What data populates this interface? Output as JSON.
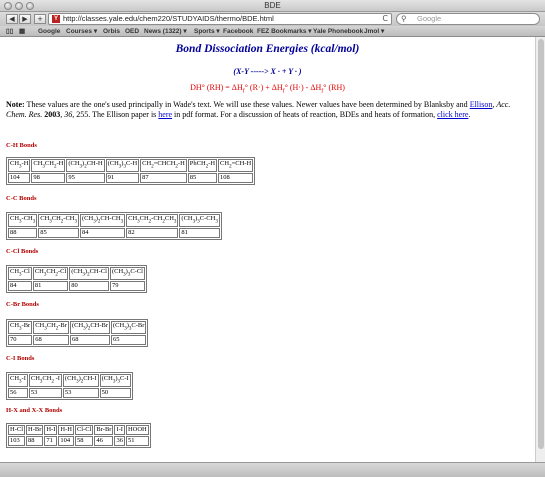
{
  "window": {
    "title": "BDE"
  },
  "toolbar": {
    "back": "◀",
    "forward": "▶",
    "add": "+",
    "url": "http://classes.yale.edu/chem220/STUDYAIDS/thermo/BDE.html",
    "reload": "C",
    "search_placeholder": "Google"
  },
  "bookmarks": [
    "Google",
    "Courses ▾",
    "Orbis",
    "OED",
    "News (1322) ▾",
    "Sports ▾",
    "Facebook",
    "FEZ Bookmarks ▾",
    "Yale Phonebook",
    "Jmol ▾"
  ],
  "page": {
    "heading": "Bond Dissociation Energies (kcal/mol)",
    "reaction": "(X-Y -----> X · + Y · )",
    "formula": "DH° (RH) = ΔHf° (R·) + ΔHf° (H·) - ΔHf° (RH)",
    "note": {
      "label": "Note:",
      "t1": " These values are the one's used principally in Wade's text. We will use these values. Newer values have been determined by Blanksby and ",
      "link1": "Ellison",
      "t2": ", ",
      "journal": "Acc. Chem. Res.",
      "t3": " ",
      "year": "2003",
      "t4": ", ",
      "vol": "36",
      "t5": ", 255. The Ellison paper is ",
      "link2": "here",
      "t6": " in pdf format. For a discussion of heats of reaction, BDEs and heats of formation, ",
      "link3": "click here",
      "t7": "."
    },
    "sections": [
      {
        "title": "C-H Bonds",
        "headers": [
          "CH3-H",
          "CH3CH2-H",
          "(CH3)2CH-H",
          "(CH3)3C-H",
          "CH2=CHCH2-H",
          "PhCH2-H",
          "CH2=CH-H"
        ],
        "values": [
          "104",
          "98",
          "95",
          "91",
          "87",
          "85",
          "108"
        ]
      },
      {
        "title": "C-C Bonds",
        "headers": [
          "CH3-CH3",
          "CH3CH2-CH3",
          "(CH3)2CH-CH3",
          "CH3CH2-CH2CH3",
          "(CH3)3C-CH3"
        ],
        "values": [
          "88",
          "85",
          "84",
          "82",
          "81"
        ]
      },
      {
        "title": "C-Cl Bonds",
        "headers": [
          "CH3-Cl",
          "CH3CH2-Cl",
          "(CH3)2CH-Cl",
          "(CH3)3C-Cl"
        ],
        "values": [
          "84",
          "81",
          "80",
          "79"
        ]
      },
      {
        "title": "C-Br Bonds",
        "headers": [
          "CH3-Br",
          "CH3CH2-Br",
          "(CH3)2CH-Br",
          "(CH3)3C-Br"
        ],
        "values": [
          "70",
          "68",
          "68",
          "65"
        ]
      },
      {
        "title": "C-I Bonds",
        "headers": [
          "CH3-I",
          "CH3CH2 -I",
          "(CH3)2CH-I",
          "(CH3)3C-I"
        ],
        "values": [
          "56",
          "53",
          "53",
          "50"
        ]
      },
      {
        "title": "H-X and X-X Bonds",
        "headers": [
          "H-Cl",
          "H-Br",
          "H-I",
          "H-H",
          "Cl-Cl",
          "Br-Br",
          "I-I",
          "HOOH"
        ],
        "values": [
          "103",
          "88",
          "71",
          "104",
          "58",
          "46",
          "36",
          "51"
        ]
      }
    ]
  }
}
